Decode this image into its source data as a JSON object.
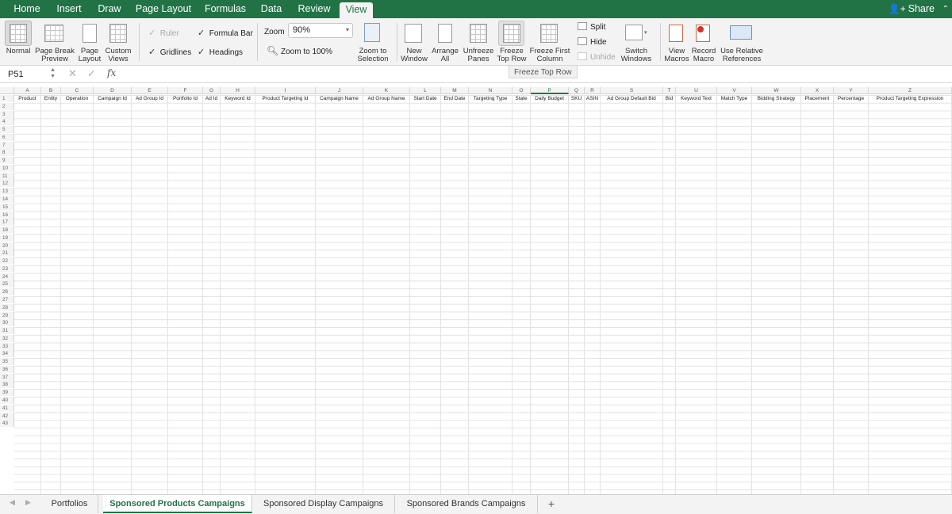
{
  "ribbon_tabs": [
    "Home",
    "Insert",
    "Draw",
    "Page Layout",
    "Formulas",
    "Data",
    "Review",
    "View"
  ],
  "active_tab": "View",
  "share_label": "Share",
  "ribbon": {
    "workbook_views": {
      "normal": "Normal",
      "page_break_preview": [
        "Page Break",
        "Preview"
      ],
      "page_layout": [
        "Page",
        "Layout"
      ],
      "custom_views": [
        "Custom",
        "Views"
      ]
    },
    "show": {
      "ruler": "Ruler",
      "formula_bar": "Formula Bar",
      "gridlines": "Gridlines",
      "headings": "Headings"
    },
    "zoom": {
      "label": "Zoom",
      "value": "90%",
      "zoom_100": "Zoom to 100%",
      "zoom_to_selection": [
        "Zoom to",
        "Selection"
      ]
    },
    "window": {
      "new_window": [
        "New",
        "Window"
      ],
      "arrange_all": [
        "Arrange",
        "All"
      ],
      "unfreeze_panes": [
        "Unfreeze",
        "Panes"
      ],
      "freeze_top_row": [
        "Freeze",
        "Top Row"
      ],
      "freeze_first_column": [
        "Freeze First",
        "Column"
      ],
      "split": "Split",
      "hide": "Hide",
      "unhide": "Unhide",
      "switch_windows": [
        "Switch",
        "Windows"
      ]
    },
    "macros": {
      "view_macros": [
        "View",
        "Macros"
      ],
      "record_macro": [
        "Record",
        "Macro"
      ],
      "use_relative": [
        "Use Relative",
        "References"
      ]
    }
  },
  "tooltip": "Freeze Top Row",
  "formula_bar": {
    "name_box": "P51",
    "fx": "fx"
  },
  "columns": [
    "A",
    "B",
    "C",
    "D",
    "E",
    "F",
    "G",
    "H",
    "I",
    "J",
    "K",
    "L",
    "M",
    "N",
    "O",
    "P",
    "Q",
    "R",
    "S",
    "T",
    "U",
    "V",
    "W",
    "X",
    "Y",
    "Z"
  ],
  "selected_column": "P",
  "header_row": [
    "Product",
    "Entity",
    "Operation",
    "Campaign Id",
    "Ad Group Id",
    "Portfolio Id",
    "Ad Id",
    "Keyword Id",
    "Product Targeting Id",
    "Campaign Name",
    "Ad Group Name",
    "Start Date",
    "End Date",
    "Targeting Type",
    "State",
    "Daily Budget",
    "SKU",
    "ASIN",
    "Ad Group Default Bid",
    "Bid",
    "Keyword Text",
    "Match Type",
    "Bidding Strategy",
    "Placement",
    "Percentage",
    "Product Targeting Expression"
  ],
  "row_numbers": [
    "1",
    "2",
    "3",
    "4",
    "5",
    "6",
    "7",
    "8",
    "9",
    "10",
    "11",
    "12",
    "13",
    "14",
    "15",
    "16",
    "17",
    "18",
    "19",
    "20",
    "21",
    "22",
    "23",
    "24",
    "25",
    "26",
    "27",
    "28",
    "29",
    "30",
    "31",
    "32",
    "33",
    "34",
    "35",
    "36",
    "37",
    "38",
    "39",
    "40",
    "41",
    "42",
    "43"
  ],
  "sheet_tabs": [
    "Portfolios",
    "Sponsored Products Campaigns",
    "Sponsored Display Campaigns",
    "Sponsored Brands Campaigns"
  ],
  "active_sheet": "Sponsored Products Campaigns",
  "colors": {
    "accent": "#217346"
  }
}
